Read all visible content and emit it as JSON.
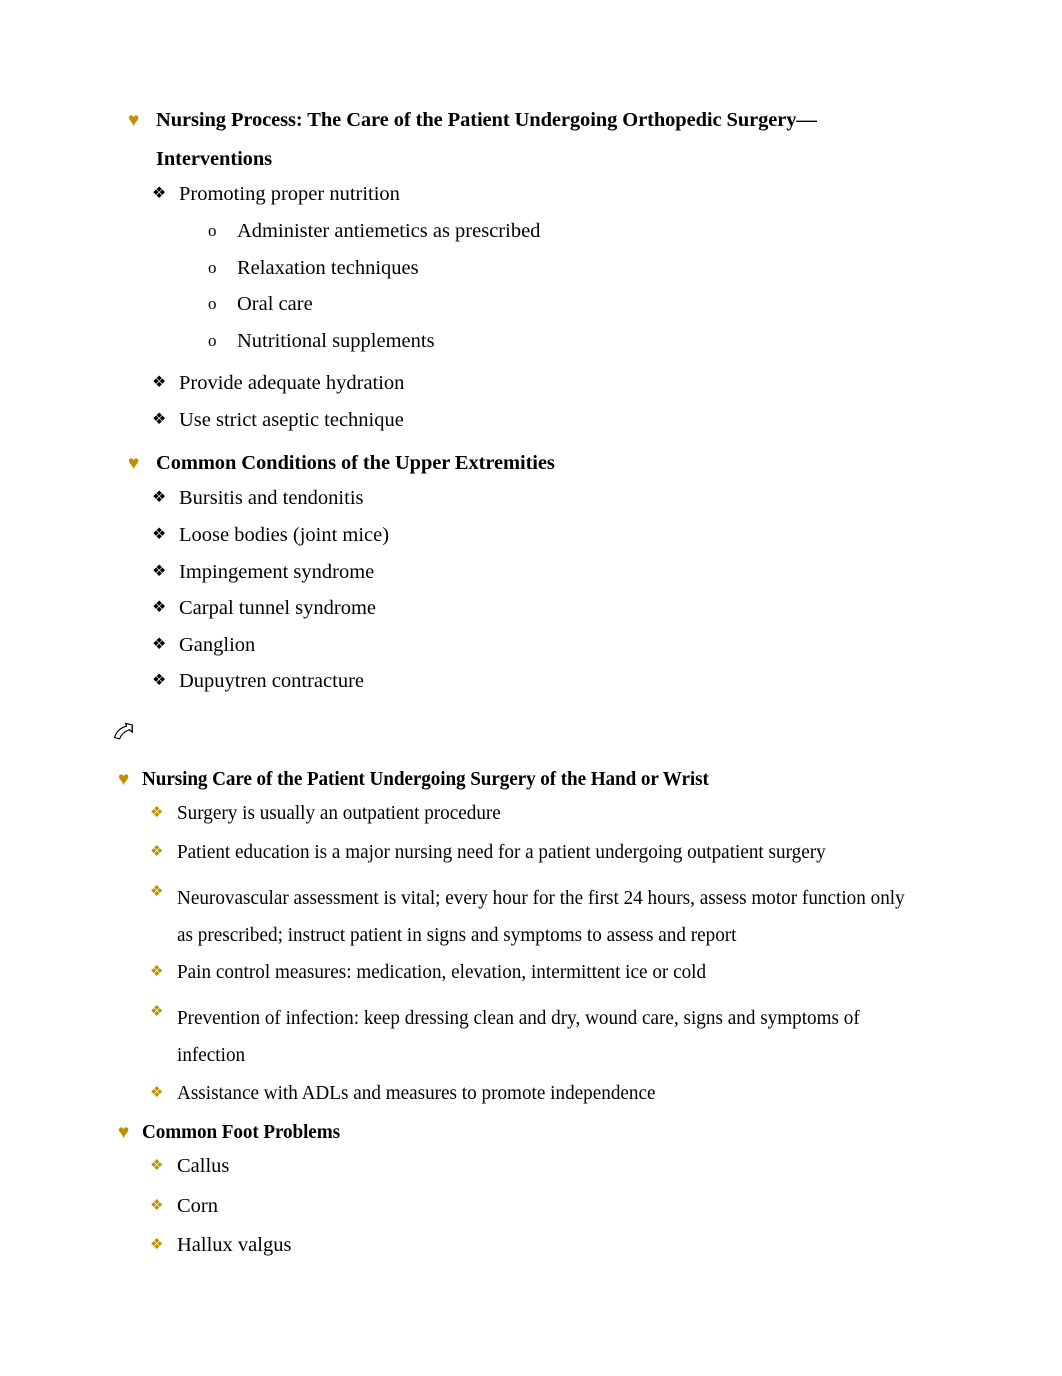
{
  "document": {
    "accent_color": "#BF8F00",
    "text_color": "#000000",
    "background_color": "#FFFFFF",
    "bullets": {
      "level1": "♥",
      "level2": "❖",
      "level3": "o"
    },
    "sections": [
      {
        "id": "nursing-process-interventions",
        "heading_line1": "Nursing Process: The Care of the Patient Undergoing Orthopedic Surgery—",
        "heading_line2": "Interventions",
        "items": [
          {
            "text": "Promoting proper nutrition",
            "subitems": [
              "Administer antiemetics as prescribed",
              "Relaxation techniques",
              "Oral care",
              "Nutritional supplements"
            ]
          },
          {
            "text": "Provide adequate hydration",
            "subitems": []
          },
          {
            "text": "Use strict aseptic technique",
            "subitems": []
          }
        ]
      },
      {
        "id": "common-conditions-upper-extremities",
        "heading_line1": "Common Conditions of the Upper Extremities",
        "items": [
          {
            "text": "Bursitis and tendonitis",
            "subitems": []
          },
          {
            "text": "Loose bodies (joint mice)",
            "subitems": []
          },
          {
            "text": "Impingement syndrome",
            "subitems": []
          },
          {
            "text": "Carpal tunnel syndrome",
            "subitems": []
          },
          {
            "text": "Ganglion",
            "subitems": []
          },
          {
            "text": "Dupuytren contracture",
            "subitems": []
          }
        ]
      },
      {
        "id": "nursing-care-hand-wrist",
        "heading_line1": "Nursing Care of the Patient Undergoing Surgery of the Hand or Wrist",
        "items": [
          {
            "text": "Surgery is usually an outpatient procedure",
            "subitems": []
          },
          {
            "text": "Patient education is a major nursing need for a patient undergoing outpatient surgery",
            "subitems": []
          },
          {
            "text": "Neurovascular assessment is vital; every hour for the first 24 hours, assess motor function only as prescribed; instruct patient in signs and symptoms to assess and report",
            "subitems": []
          },
          {
            "text": "Pain control measures: medication, elevation, intermittent ice or cold",
            "subitems": []
          },
          {
            "text": "Prevention of infection: keep dressing clean and dry, wound care, signs and symptoms of infection",
            "subitems": []
          },
          {
            "text": "Assistance with ADLs and measures to promote independence",
            "subitems": []
          }
        ]
      },
      {
        "id": "common-foot-problems",
        "heading_line1": "Common Foot Problems",
        "items": [
          {
            "text": "Callus",
            "subitems": []
          },
          {
            "text": "Corn",
            "subitems": []
          },
          {
            "text": "Hallux valgus",
            "subitems": []
          }
        ]
      }
    ],
    "ornament": {
      "name": "curved-ribbon-arrow-icon",
      "glyph": "↲"
    }
  }
}
